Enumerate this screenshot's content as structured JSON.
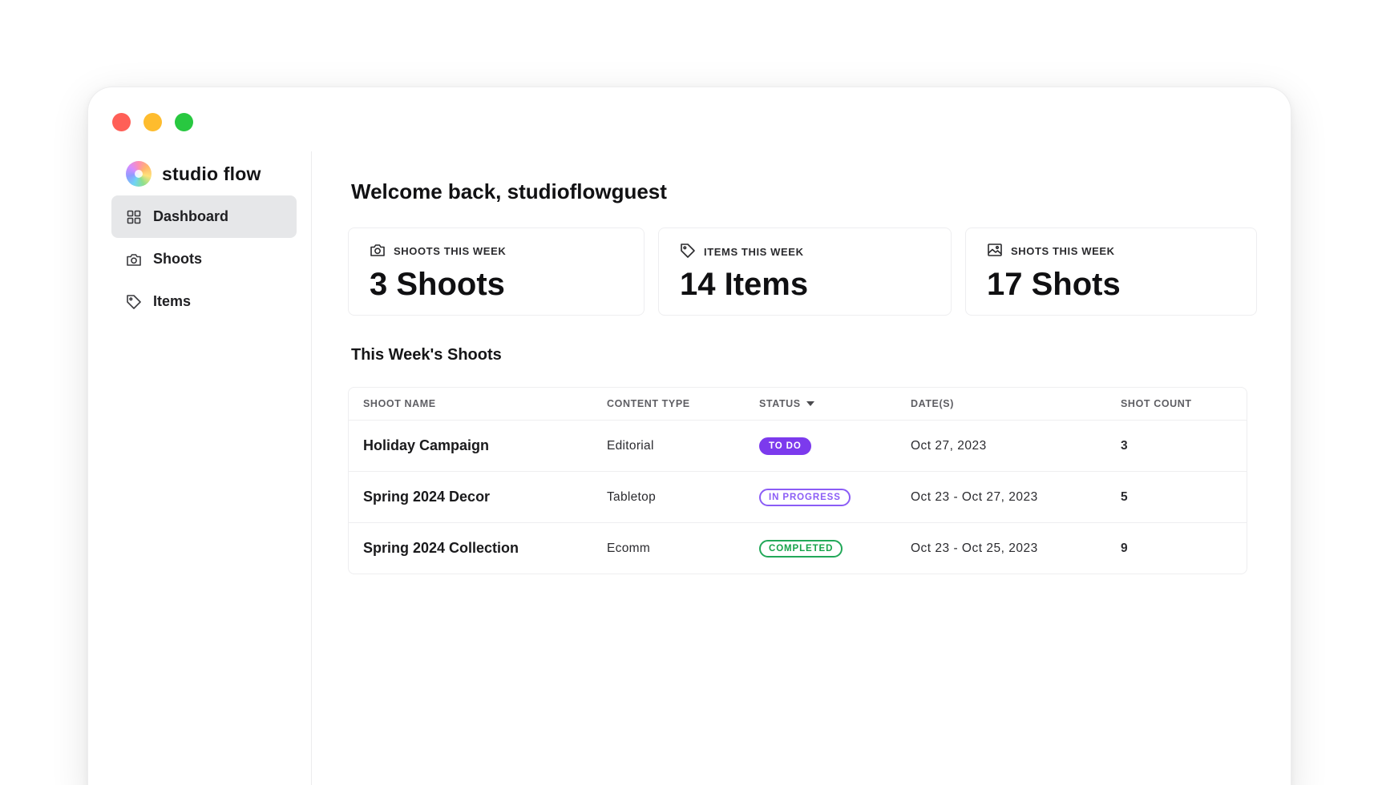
{
  "window": {
    "controls": [
      "close",
      "minimize",
      "maximize"
    ]
  },
  "brand": {
    "name": "studio flow",
    "logo_icon": "flower-logo-icon"
  },
  "sidebar": {
    "items": [
      {
        "label": "Dashboard",
        "icon": "grid-icon",
        "active": true
      },
      {
        "label": "Shoots",
        "icon": "camera-icon",
        "active": false
      },
      {
        "label": "Items",
        "icon": "tag-icon",
        "active": false
      }
    ]
  },
  "main": {
    "welcome": "Welcome back, studioflowguest",
    "stats": [
      {
        "label": "SHOOTS THIS WEEK",
        "value": "3 Shoots",
        "icon": "camera-icon"
      },
      {
        "label": "ITEMS THIS WEEK",
        "value": "14 Items",
        "icon": "tag-icon"
      },
      {
        "label": "SHOTS THIS WEEK",
        "value": "17 Shots",
        "icon": "image-icon"
      }
    ],
    "section_title": "This Week's Shoots",
    "table": {
      "columns": [
        "SHOOT NAME",
        "CONTENT TYPE",
        "STATUS",
        "DATE(S)",
        "SHOT COUNT"
      ],
      "rows": [
        {
          "name": "Holiday Campaign",
          "content_type": "Editorial",
          "status": "TO DO",
          "dates": "Oct 27, 2023",
          "shot_count": "3"
        },
        {
          "name": "Spring 2024 Decor",
          "content_type": "Tabletop",
          "status": "IN PROGRESS",
          "dates": "Oct 23 - Oct 27, 2023",
          "shot_count": "5"
        },
        {
          "name": "Spring 2024 Collection",
          "content_type": "Ecomm",
          "status": "COMPLETED",
          "dates": "Oct 23 - Oct 25, 2023",
          "shot_count": "9"
        }
      ]
    }
  },
  "colors": {
    "todo": "#7c3aed",
    "in_progress": "#8b5cf6",
    "completed": "#16a34a",
    "active_nav_bg": "#e6e7e9"
  }
}
